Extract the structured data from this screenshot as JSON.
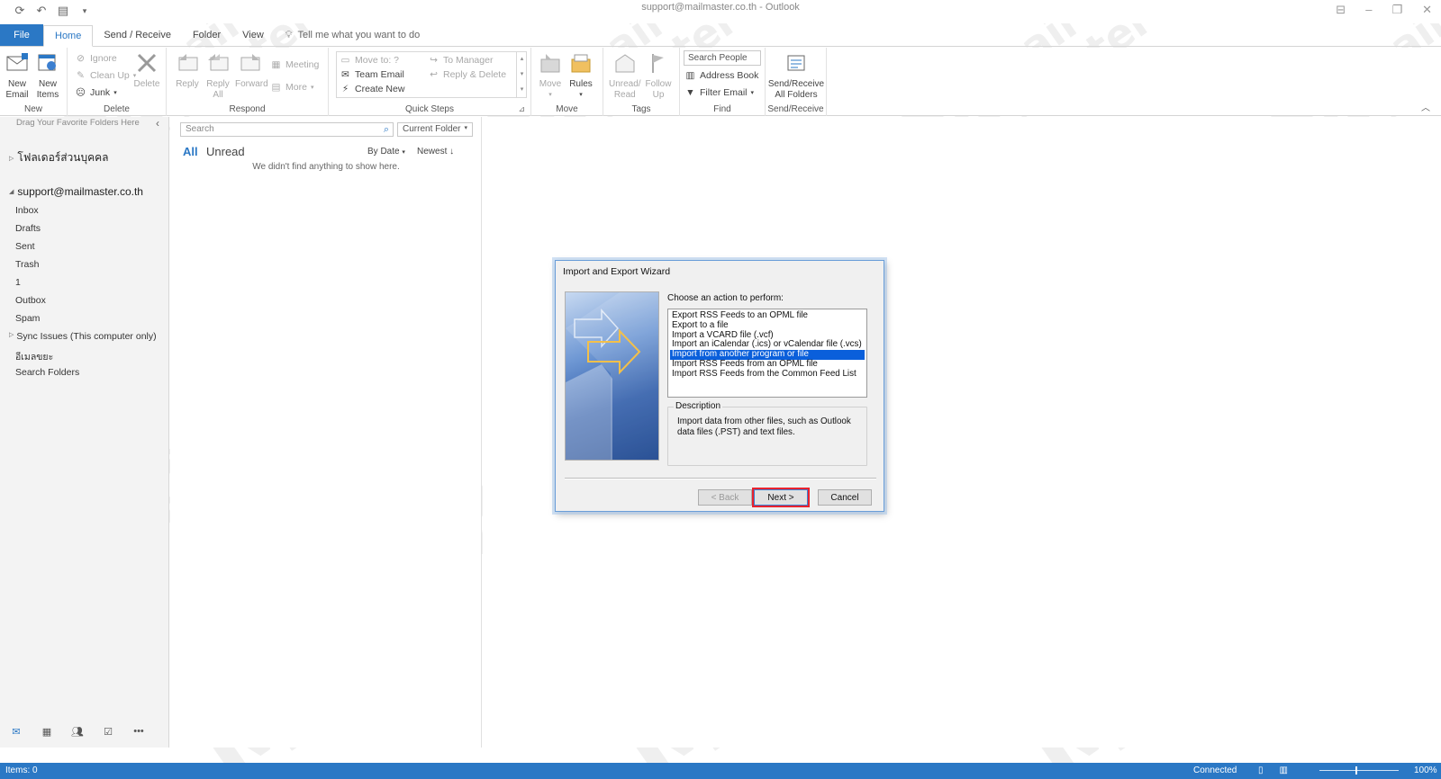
{
  "window": {
    "title": "support@mailmaster.co.th  -  Outlook"
  },
  "tabs": [
    {
      "label": "File"
    },
    {
      "label": "Home"
    },
    {
      "label": "Send / Receive"
    },
    {
      "label": "Folder"
    },
    {
      "label": "View"
    }
  ],
  "tell_me": "Tell me what you want to do",
  "ribbon": {
    "new": {
      "label": "New",
      "new_email": "New\nEmail",
      "new_items": "New\nItems"
    },
    "delete": {
      "label": "Delete",
      "ignore": "Ignore",
      "clean_up": "Clean Up",
      "junk": "Junk",
      "delete": "Delete"
    },
    "respond": {
      "label": "Respond",
      "reply": "Reply",
      "reply_all": "Reply\nAll",
      "forward": "Forward",
      "meeting": "Meeting",
      "more": "More"
    },
    "quick_steps": {
      "label": "Quick Steps",
      "move_to": "Move to: ?",
      "team_email": "Team Email",
      "create_new": "Create New",
      "to_manager": "To Manager",
      "reply_delete": "Reply & Delete"
    },
    "move": {
      "label": "Move",
      "move": "Move",
      "rules": "Rules"
    },
    "tags": {
      "label": "Tags",
      "unread_read": "Unread/\nRead",
      "follow_up": "Follow\nUp"
    },
    "find": {
      "label": "Find",
      "search_people": "Search People",
      "address_book": "Address Book",
      "filter_email": "Filter Email"
    },
    "send_receive": {
      "label": "Send/Receive",
      "all_folders": "Send/Receive\nAll Folders"
    }
  },
  "folder_pane": {
    "favorites_hint": "Drag Your Favorite Folders Here",
    "personal_folders": "โฟลเดอร์ส่วนบุคคล",
    "account": "support@mailmaster.co.th",
    "folders": [
      "Inbox",
      "Drafts",
      "Sent",
      "Trash",
      "1",
      "Outbox",
      "Spam",
      "Sync Issues (This computer only)",
      "อีเมลขยะ",
      "Search Folders"
    ]
  },
  "message_list": {
    "search_placeholder": "Search",
    "scope": "Current Folder",
    "filter_all": "All",
    "filter_unread": "Unread",
    "sort_by": "By Date",
    "sort_order": "Newest",
    "empty": "We didn't find anything to show here."
  },
  "status_bar": {
    "items": "Items: 0",
    "connection": "Connected",
    "zoom": "100%"
  },
  "dialog": {
    "title": "Import and Export Wizard",
    "prompt": "Choose an action to perform:",
    "actions": [
      "Export RSS Feeds to an OPML file",
      "Export to a file",
      "Import a VCARD file (.vcf)",
      "Import an iCalendar (.ics) or vCalendar file (.vcs)",
      "Import from another program or file",
      "Import RSS Feeds from an OPML file",
      "Import RSS Feeds from the Common Feed List"
    ],
    "selected_index": 4,
    "description_label": "Description",
    "description": "Import data from other files, such as Outlook data files (.PST) and text files.",
    "back_label": "< Back",
    "next_label": "Next >",
    "cancel_label": "Cancel"
  },
  "watermark": {
    "line1": "mail",
    "line2": "master"
  },
  "colors": {
    "accent": "#2b78c5",
    "selection": "#0a5fdb",
    "highlight_border": "#e8222e"
  }
}
